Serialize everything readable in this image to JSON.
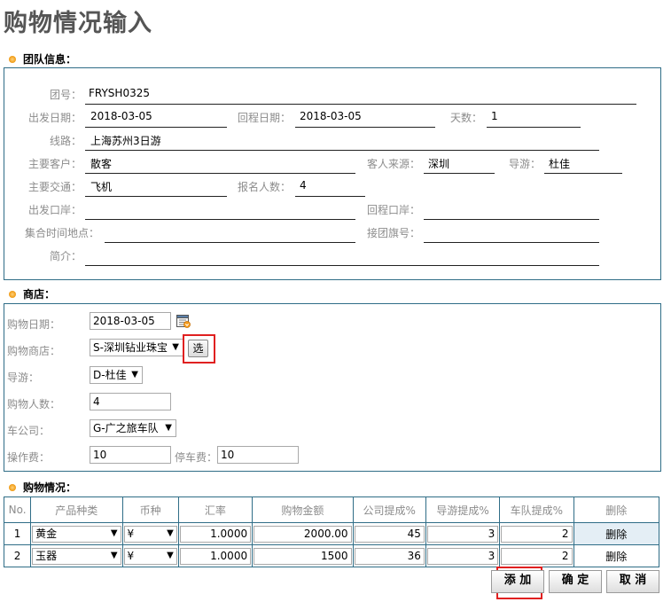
{
  "page": {
    "title": "购物情况输入"
  },
  "team": {
    "heading": "团队信息：",
    "group_no": {
      "label": "团号：",
      "value": "FRYSH0325"
    },
    "depart_date": {
      "label": "出发日期：",
      "value": "2018-03-05"
    },
    "return_date": {
      "label": "回程日期：",
      "value": "2018-03-05"
    },
    "days": {
      "label": "天数：",
      "value": "1"
    },
    "route": {
      "label": "线路：",
      "value": "上海苏州3日游"
    },
    "client": {
      "label": "主要客户：",
      "value": "散客"
    },
    "source": {
      "label": "客人来源：",
      "value": "深圳"
    },
    "guide": {
      "label": "导游：",
      "value": "杜佳"
    },
    "transport": {
      "label": "主要交通：",
      "value": "飞机"
    },
    "signup_count": {
      "label": "报名人数：",
      "value": "4"
    },
    "depart_port": {
      "label": "出发口岸：",
      "value": ""
    },
    "return_port": {
      "label": "回程口岸：",
      "value": ""
    },
    "meeting": {
      "label": "集合时间地点：",
      "value": ""
    },
    "flag_no": {
      "label": "接团旗号：",
      "value": ""
    },
    "intro": {
      "label": "简介：",
      "value": ""
    }
  },
  "shop": {
    "heading": "商店：",
    "date": {
      "label": "购物日期：",
      "value": "2018-03-05"
    },
    "store": {
      "label": "购物商店：",
      "value": "S-深圳钻业珠宝",
      "pick_label": "选"
    },
    "guide": {
      "label": "导游：",
      "value": "D-杜佳"
    },
    "people": {
      "label": "购物人数：",
      "value": "4"
    },
    "car": {
      "label": "车公司：",
      "value": "G-广之旅车队"
    },
    "op_fee": {
      "label": "操作费：",
      "value": "10"
    },
    "parking_fee": {
      "label": "停车费：",
      "value": "10"
    }
  },
  "purchases": {
    "heading": "购物情况：",
    "columns": [
      "No.",
      "产品种类",
      "币种",
      "汇率",
      "购物金额",
      "公司提成%",
      "导游提成%",
      "车队提成%",
      "删除"
    ],
    "rows": [
      {
        "no": "1",
        "product": "黄金",
        "currency": "¥",
        "rate": "1.0000",
        "amount": "2000.00",
        "company": "45",
        "guide": "3",
        "team": "2",
        "del": "删除"
      },
      {
        "no": "2",
        "product": "玉器",
        "currency": "¥",
        "rate": "1.0000",
        "amount": "1500",
        "company": "36",
        "guide": "3",
        "team": "2",
        "del": "删除"
      }
    ]
  },
  "actions": {
    "add": "添 加",
    "ok": "确 定",
    "cancel": "取 消"
  },
  "colors": {
    "border": "#2f6d87",
    "highlight": "#e02020",
    "label": "#8c8c8c"
  },
  "icons": {
    "section": "bullet-icon",
    "calendar": "calendar-icon",
    "dropdown": "chevron-down-icon"
  }
}
